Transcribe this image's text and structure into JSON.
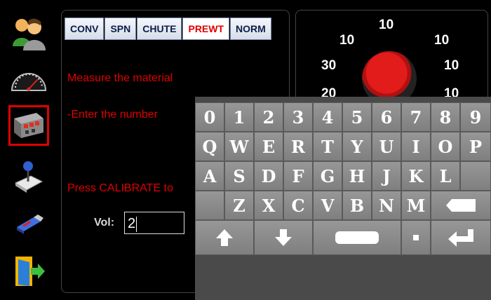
{
  "tabs": [
    {
      "label": "CONV"
    },
    {
      "label": "SPN"
    },
    {
      "label": "CHUTE"
    },
    {
      "label": "PREWT",
      "active": true
    },
    {
      "label": "NORM"
    }
  ],
  "messages": {
    "line1": "Measure the material",
    "line2": "-Enter the number",
    "line3": "Press CALIBRATE to"
  },
  "volume": {
    "label": "Vol:",
    "value": "2"
  },
  "gauge": {
    "numbers": [
      "10",
      "10",
      "10",
      "30",
      "10",
      "20",
      "10"
    ]
  },
  "keyboard": {
    "row1": [
      "0",
      "1",
      "2",
      "3",
      "4",
      "5",
      "6",
      "7",
      "8",
      "9"
    ],
    "row2": [
      "Q",
      "W",
      "E",
      "R",
      "T",
      "Y",
      "U",
      "I",
      "O",
      "P"
    ],
    "row3": [
      "A",
      "S",
      "D",
      "F",
      "G",
      "H",
      "J",
      "K",
      "L",
      ""
    ],
    "row4": [
      "",
      "Z",
      "X",
      "C",
      "V",
      "B",
      "N",
      "M",
      "backspace"
    ],
    "row5": [
      "shift-up",
      "arrow-down",
      "space",
      "dot",
      "enter"
    ]
  },
  "sidebar": {
    "items": [
      {
        "icon": "users-icon"
      },
      {
        "icon": "speedometer-icon"
      },
      {
        "icon": "valve-block-icon",
        "active": true
      },
      {
        "icon": "joystick-icon"
      },
      {
        "icon": "usb-drive-icon"
      },
      {
        "icon": "exit-door-icon"
      }
    ]
  },
  "colors": {
    "accent": "#e00000",
    "key_face": "#8a8a8a",
    "keyboard_bg": "#4a4a4a"
  }
}
